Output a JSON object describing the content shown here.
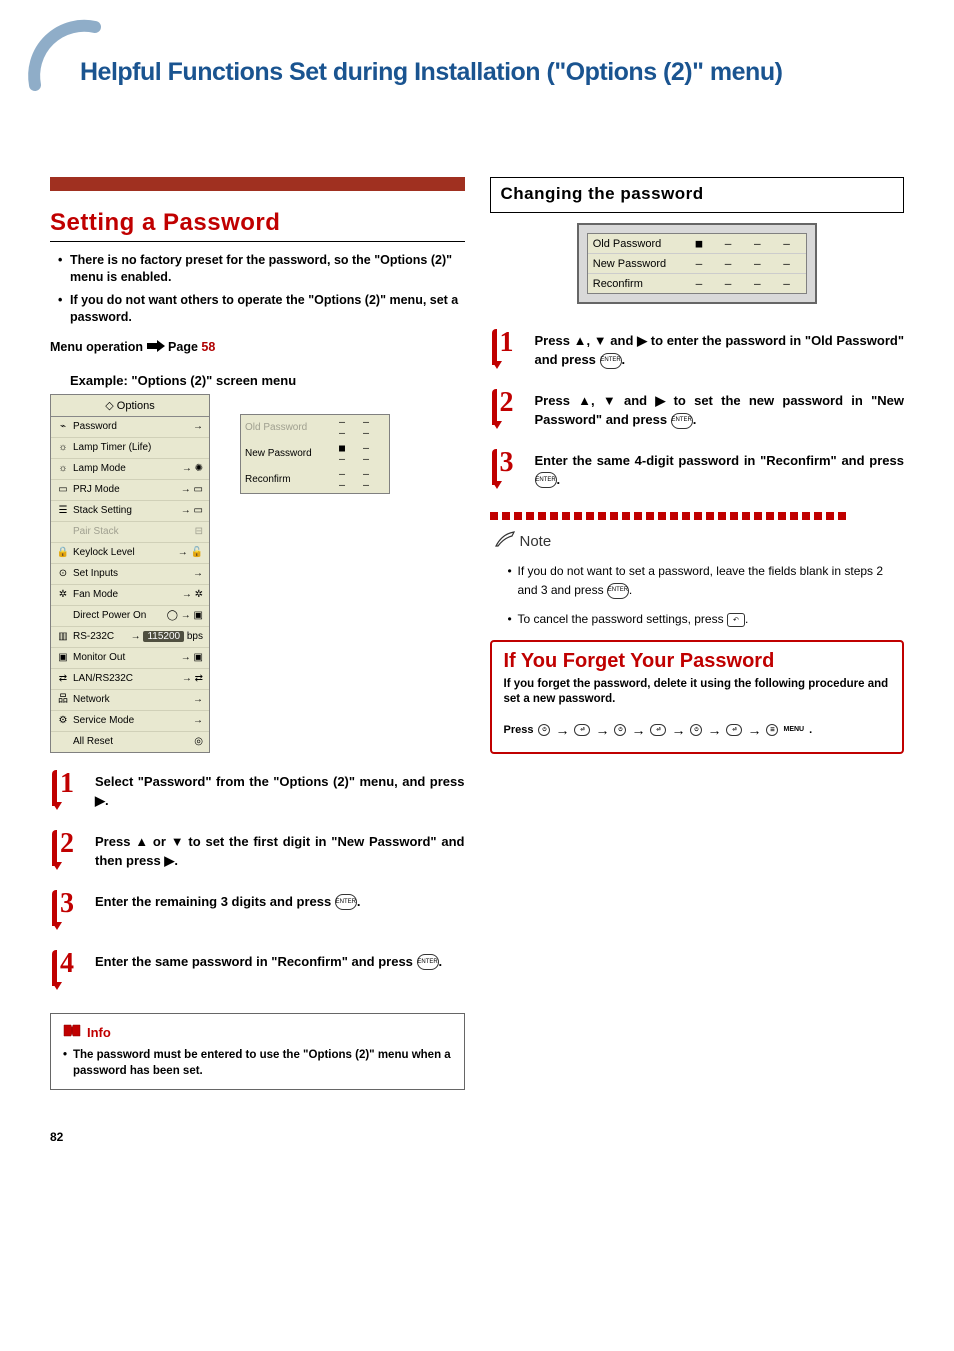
{
  "page_number": "82",
  "header": {
    "title": "Helpful Functions Set during Installation (\"Options (2)\" menu)"
  },
  "left": {
    "section_title": "Setting a Password",
    "bullets": [
      "There is no factory preset for the password, so the \"Options (2)\" menu is enabled.",
      "If you do not want others to operate the \"Options (2)\" menu, set a password."
    ],
    "menu_op_prefix": "Menu operation",
    "menu_op_page_label": "Page",
    "menu_op_page": "58",
    "example_label": "Example: \"Options (2)\" screen menu",
    "osd": {
      "title": "Options",
      "items": [
        {
          "label": "Password",
          "suffix": "→"
        },
        {
          "label": "Lamp Timer (Life)",
          "suffix": ""
        },
        {
          "label": "Lamp Mode",
          "suffix": "→"
        },
        {
          "label": "PRJ Mode",
          "suffix": "→"
        },
        {
          "label": "Stack Setting",
          "suffix": "→"
        },
        {
          "label": "Pair Stack",
          "suffix": "",
          "disabled": true
        },
        {
          "label": "Keylock Level",
          "suffix": "→"
        },
        {
          "label": "Set Inputs",
          "suffix": "→"
        },
        {
          "label": "Fan Mode",
          "suffix": "→"
        },
        {
          "label": "Direct Power On",
          "suffix": "→"
        },
        {
          "label": "RS-232C",
          "suffix_hl": "115200",
          "suffix_post": "bps"
        },
        {
          "label": "Monitor Out",
          "suffix": "→"
        },
        {
          "label": "LAN/RS232C",
          "suffix": "→"
        },
        {
          "label": "Network",
          "suffix": "→"
        },
        {
          "label": "Service Mode",
          "suffix": "→"
        },
        {
          "label": "All Reset",
          "suffix": ""
        }
      ]
    },
    "pw_panel": {
      "rows": [
        {
          "label": "Old Password",
          "dim": true,
          "val": "– – – –"
        },
        {
          "label": "New Password",
          "val": "■ – – –"
        },
        {
          "label": "Reconfirm",
          "val": "– – – –"
        }
      ]
    },
    "steps": [
      "Select \"Password\" from the \"Options (2)\" menu, and press ▶.",
      "Press ▲ or ▼ to set the first digit in \"New Password\" and then press ▶.",
      "Enter the remaining 3 digits and press ⏎.",
      "Enter the same password in \"Reconfirm\" and press ⏎."
    ],
    "info_label": "Info",
    "info_text": "The password must be entered to use the \"Options (2)\" menu when a password has been set."
  },
  "right": {
    "changing_title": "Changing the password",
    "pw_panel": {
      "rows": [
        {
          "label": "Old Password",
          "val": "■ – – –"
        },
        {
          "label": "New Password",
          "val": "– – – –"
        },
        {
          "label": "Reconfirm",
          "val": "– – – –"
        }
      ]
    },
    "steps": [
      "Press ▲, ▼ and ▶ to enter the password in \"Old Password\" and press ⏎.",
      "Press ▲, ▼ and ▶ to set the new password in \"New Password\" and press ⏎.",
      "Enter the same 4-digit password in \"Reconfirm\" and press ⏎."
    ],
    "note_label": "Note",
    "notes": [
      "If you do not want to set a password, leave the fields blank in steps 2 and 3 and press ⏎.",
      "To cancel the password settings, press 🔙."
    ],
    "forget": {
      "title": "If You Forget Your Password",
      "sub": "If you forget the password, delete it using the following procedure and set a new password.",
      "press_label": "Press"
    }
  }
}
